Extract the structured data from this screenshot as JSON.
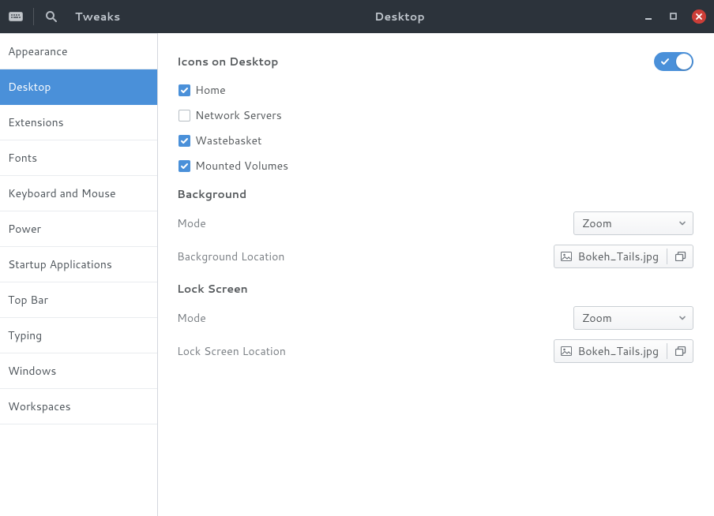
{
  "header": {
    "app_title": "Tweaks",
    "page_title": "Desktop"
  },
  "sidebar": {
    "items": [
      {
        "label": "Appearance",
        "selected": false
      },
      {
        "label": "Desktop",
        "selected": true
      },
      {
        "label": "Extensions",
        "selected": false
      },
      {
        "label": "Fonts",
        "selected": false
      },
      {
        "label": "Keyboard and Mouse",
        "selected": false
      },
      {
        "label": "Power",
        "selected": false
      },
      {
        "label": "Startup Applications",
        "selected": false
      },
      {
        "label": "Top Bar",
        "selected": false
      },
      {
        "label": "Typing",
        "selected": false
      },
      {
        "label": "Windows",
        "selected": false
      },
      {
        "label": "Workspaces",
        "selected": false
      }
    ]
  },
  "main": {
    "icons_section": {
      "title": "Icons on Desktop",
      "enabled": true,
      "options": [
        {
          "label": "Home",
          "checked": true
        },
        {
          "label": "Network Servers",
          "checked": false
        },
        {
          "label": "Wastebasket",
          "checked": true
        },
        {
          "label": "Mounted Volumes",
          "checked": true
        }
      ]
    },
    "background": {
      "title": "Background",
      "mode_label": "Mode",
      "mode_value": "Zoom",
      "location_label": "Background Location",
      "location_value": "Bokeh_Tails.jpg"
    },
    "lockscreen": {
      "title": "Lock Screen",
      "mode_label": "Mode",
      "mode_value": "Zoom",
      "location_label": "Lock Screen Location",
      "location_value": "Bokeh_Tails.jpg"
    }
  }
}
